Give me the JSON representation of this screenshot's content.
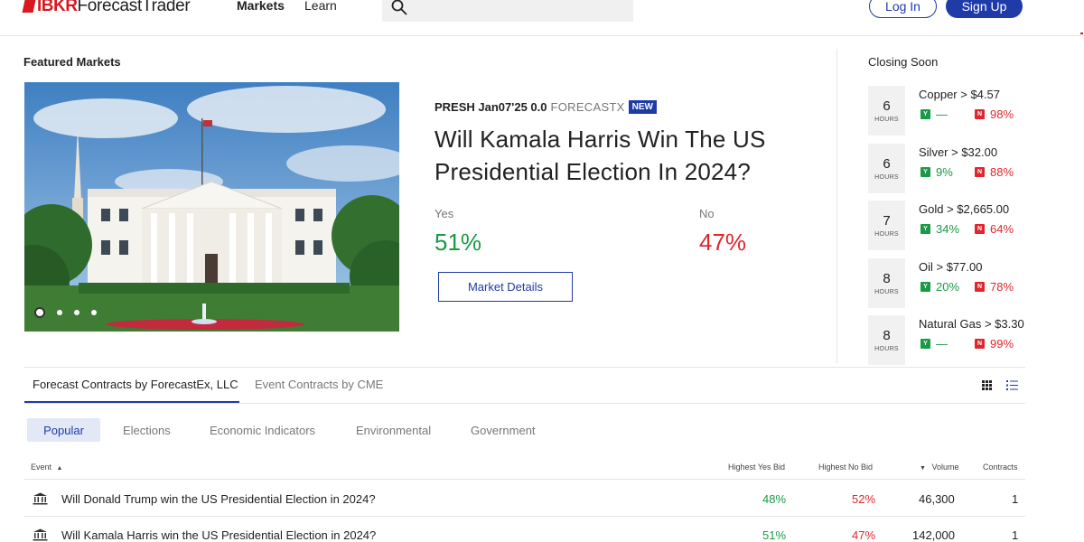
{
  "header": {
    "logo_ibkr": "IBKR",
    "logo_rest": "ForecastTrader",
    "nav": [
      "Markets",
      "Learn"
    ],
    "login": "Log In",
    "signup": "Sign Up",
    "search_icon": "search-icon"
  },
  "featured": {
    "section_title": "Featured Markets",
    "code": "PRESH Jan07'25 0.0",
    "source": "FORECASTX",
    "badge": "NEW",
    "question": "Will Kamala Harris Win The US Presidential Election In 2024?",
    "yes_label": "Yes",
    "no_label": "No",
    "yes_pct": "51%",
    "no_pct": "47%",
    "details_button": "Market Details",
    "carousel_total_slides": 4,
    "carousel_active_slide": 1
  },
  "closing_soon": {
    "title": "Closing Soon",
    "items": [
      {
        "num": "6",
        "unit": "HOURS",
        "name": "Copper > $4.57",
        "yes": "—",
        "no": "98%"
      },
      {
        "num": "6",
        "unit": "HOURS",
        "name": "Silver > $32.00",
        "yes": "9%",
        "no": "88%"
      },
      {
        "num": "7",
        "unit": "HOURS",
        "name": "Gold > $2,665.00",
        "yes": "34%",
        "no": "64%"
      },
      {
        "num": "8",
        "unit": "HOURS",
        "name": "Oil > $77.00",
        "yes": "20%",
        "no": "78%"
      },
      {
        "num": "8",
        "unit": "HOURS",
        "name": "Natural Gas > $3.30",
        "yes": "—",
        "no": "99%"
      }
    ],
    "yes_tag": "Y",
    "no_tag": "N"
  },
  "tabs": {
    "active": "Forecast Contracts by ForecastEx, LLC",
    "inactive": "Event Contracts by CME"
  },
  "categories": [
    "Popular",
    "Elections",
    "Economic Indicators",
    "Environmental",
    "Government"
  ],
  "table": {
    "headers": {
      "event": "Event",
      "yes_bid": "Highest Yes Bid",
      "no_bid": "Highest No Bid",
      "volume": "Volume",
      "contracts": "Contracts"
    },
    "rows": [
      {
        "event": "Will Donald Trump win the US Presidential Election in 2024?",
        "yes": "48%",
        "no": "52%",
        "volume": "46,300",
        "contracts": "1"
      },
      {
        "event": "Will Kamala Harris win the US Presidential Election in 2024?",
        "yes": "51%",
        "no": "47%",
        "volume": "142,000",
        "contracts": "1"
      }
    ]
  },
  "colors": {
    "brand_red": "#d71920",
    "accent_blue": "#1f3ba8",
    "yes_green": "#1a9a44",
    "no_red": "#e0262c"
  }
}
